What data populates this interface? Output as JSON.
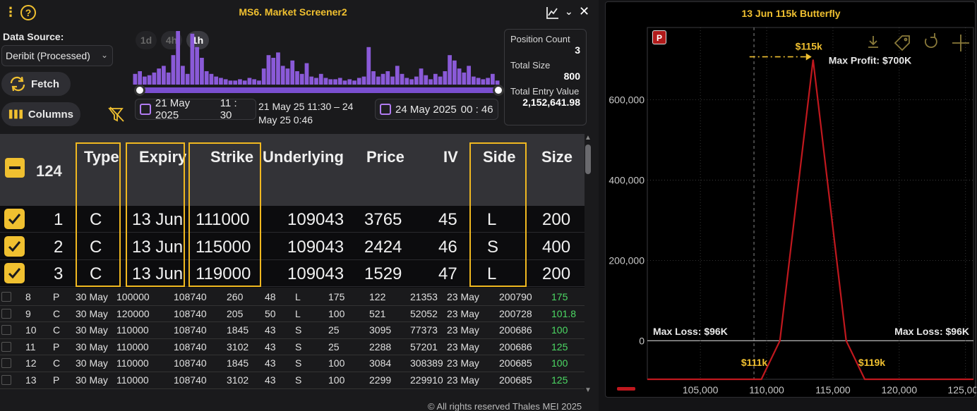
{
  "window": {
    "title": "MS6. Market Screener2",
    "kebab": "⋮",
    "help": "?",
    "chevron": "⌄",
    "close": "✕"
  },
  "data_source": {
    "label": "Data Source:",
    "value": "Deribit (Processed)"
  },
  "buttons": {
    "fetch": "Fetch",
    "columns": "Columns"
  },
  "timeframes": [
    "1d",
    "4h",
    "1h"
  ],
  "active_timeframe": "1h",
  "histogram": {
    "color": "#8a5ad8",
    "values": [
      8,
      10,
      6,
      7,
      9,
      12,
      14,
      9,
      22,
      40,
      14,
      8,
      38,
      28,
      20,
      10,
      8,
      6,
      5,
      4,
      3,
      3,
      4,
      3,
      5,
      4,
      3,
      12,
      22,
      20,
      24,
      14,
      12,
      18,
      10,
      8,
      16,
      6,
      5,
      8,
      5,
      4,
      4,
      5,
      3,
      4,
      3,
      5,
      6,
      28,
      10,
      6,
      8,
      10,
      6,
      14,
      8,
      5,
      4,
      6,
      12,
      7,
      4,
      8,
      6,
      10,
      22,
      18,
      12,
      9,
      14,
      6,
      5,
      4,
      5,
      8,
      3
    ]
  },
  "range": {
    "start_date": "21 May 2025",
    "start_time": "11 : 30",
    "end_date": "24 May 2025",
    "end_time": "00 : 46",
    "summary_line1": "21 May 25 11:30 – 24",
    "summary_line2": "May 25 0:46"
  },
  "stats": {
    "position_count_label": "Position Count",
    "position_count": "3",
    "total_size_label": "Total Size",
    "total_size": "800",
    "total_entry_value_label": "Total Entry Value",
    "total_entry_value": "2,152,641.98"
  },
  "selected_table": {
    "count": "124",
    "headers": [
      "Type",
      "Expiry",
      "Strike",
      "Underlying",
      "Price",
      "IV",
      "Side",
      "Size"
    ],
    "rows": [
      [
        "1",
        "C",
        "13 Jun",
        "111000",
        "109043",
        "3765",
        "45",
        "L",
        "200"
      ],
      [
        "2",
        "C",
        "13 Jun",
        "115000",
        "109043",
        "2424",
        "46",
        "S",
        "400"
      ],
      [
        "3",
        "C",
        "13 Jun",
        "119000",
        "109043",
        "1529",
        "47",
        "L",
        "200"
      ]
    ]
  },
  "list_table": {
    "rows": [
      [
        "8",
        "P",
        "30 May",
        "100000",
        "108740",
        "260",
        "48",
        "L",
        "175",
        "122",
        "21353",
        "23 May",
        "200790",
        "175"
      ],
      [
        "9",
        "C",
        "30 May",
        "120000",
        "108740",
        "205",
        "50",
        "L",
        "100",
        "521",
        "52052",
        "23 May",
        "200728",
        "101.8"
      ],
      [
        "10",
        "C",
        "30 May",
        "110000",
        "108740",
        "1845",
        "43",
        "S",
        "25",
        "3095",
        "77373",
        "23 May",
        "200686",
        "100"
      ],
      [
        "11",
        "P",
        "30 May",
        "110000",
        "108740",
        "3102",
        "43",
        "S",
        "25",
        "2288",
        "57201",
        "23 May",
        "200686",
        "125"
      ],
      [
        "12",
        "C",
        "30 May",
        "110000",
        "108740",
        "1845",
        "43",
        "S",
        "100",
        "3084",
        "308389",
        "23 May",
        "200685",
        "100"
      ],
      [
        "13",
        "P",
        "30 May",
        "110000",
        "108740",
        "3102",
        "43",
        "S",
        "100",
        "2299",
        "229910",
        "23 May",
        "200685",
        "125"
      ]
    ]
  },
  "footer": "© All rights reserved Thales MEI 2025",
  "payoff": {
    "title": "13 Jun 115k Butterfly",
    "badge": "P",
    "line_color": "#c0181e",
    "accent_color": "#f0c030",
    "chart_data": {
      "type": "line",
      "x": [
        101000,
        109600,
        111000,
        113500,
        116000,
        117400,
        125600
      ],
      "y": [
        -96000,
        -96000,
        0,
        700000,
        0,
        -96000,
        -96000
      ],
      "xlim": [
        101000,
        125600
      ],
      "ylim": [
        -96000,
        780000
      ],
      "x_ticks": [
        105000,
        110000,
        115000,
        120000,
        125000
      ],
      "x_tick_labels": [
        "105,000",
        "110,000",
        "115,000",
        "120,000",
        "125,000"
      ],
      "y_ticks": [
        0,
        200000,
        400000,
        600000
      ],
      "y_tick_labels": [
        "0",
        "200,000",
        "400,000",
        "600,000"
      ],
      "current_price_marker_x": 109043,
      "grid": true,
      "annotations": {
        "peak": "$115k",
        "max_profit": "Max Profit: $700K",
        "max_loss_left": "Max Loss: $96K",
        "max_loss_right": "Max Loss: $96K",
        "low_strike": "$111k",
        "high_strike": "$119k"
      }
    }
  }
}
